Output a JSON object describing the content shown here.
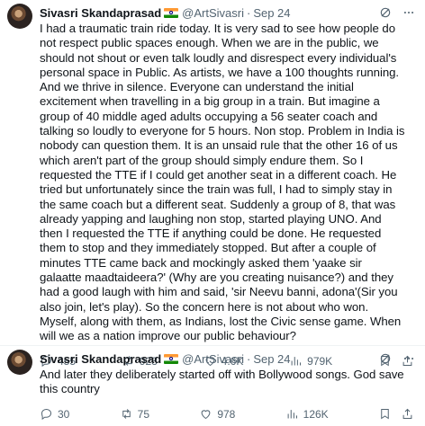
{
  "tweets": [
    {
      "author_name": "Sivasri Skandaprasad",
      "handle": "@ArtSivasri",
      "separator": "·",
      "date": "Sep 24",
      "text": "I had a traumatic train ride today. It is very sad to see how people do not respect public spaces enough. When we are in the public, we should not shout or even talk loudly and disrespect every individual's personal space in Public. As artists, we have a 100 thoughts running. And we thrive in silence. Everyone can understand the initial excitement when travelling in a big group in a train. But imagine a group of 40 middle aged adults occupying a 56 seater coach and talking so loudly to everyone for 5 hours. Non stop. Problem in India is nobody can question them. It is an unsaid rule that the other 16 of us which aren't part of the group should simply endure them. So I requested the TTE if I could get another seat in a different coach. He tried but unfortunately since the train was full, I had to simply stay in the same coach but a different seat. Suddenly a group of 8, that was already yapping and laughing non stop, started playing UNO. And then I requested the TTE if anything could be done. He requested them to stop and they immediately stopped. But after a couple of minutes TTE came back and mockingly asked them 'yaake sir galaatte maadtaideera?' (Why are you creating nuisance?) and they had a good laugh with him and said, 'sir Neevu banni, adona'(Sir you also join, let's play). So the concern here is not about who won. Myself, along with them, as Indians, lost the Civic sense game. When will we as a nation improve our public behaviour?",
      "replies": "455",
      "reposts": "923",
      "likes": "4.6K",
      "views": "979K"
    },
    {
      "author_name": "Sivasri Skandaprasad",
      "handle": "@ArtSivasri",
      "separator": "·",
      "date": "Sep 24",
      "text": "And later they deliberately started off with Bollywood songs. God save this country",
      "replies": "30",
      "reposts": "75",
      "likes": "978",
      "views": "126K"
    }
  ],
  "icons": {
    "grok": "grok-icon",
    "more": "more-icon",
    "reply": "reply-icon",
    "repost": "repost-icon",
    "like": "like-icon",
    "views": "views-icon",
    "bookmark": "bookmark-icon",
    "share": "share-icon"
  },
  "colors": {
    "text": "#0f1419",
    "secondary": "#536471",
    "border": "#eff3f4"
  }
}
